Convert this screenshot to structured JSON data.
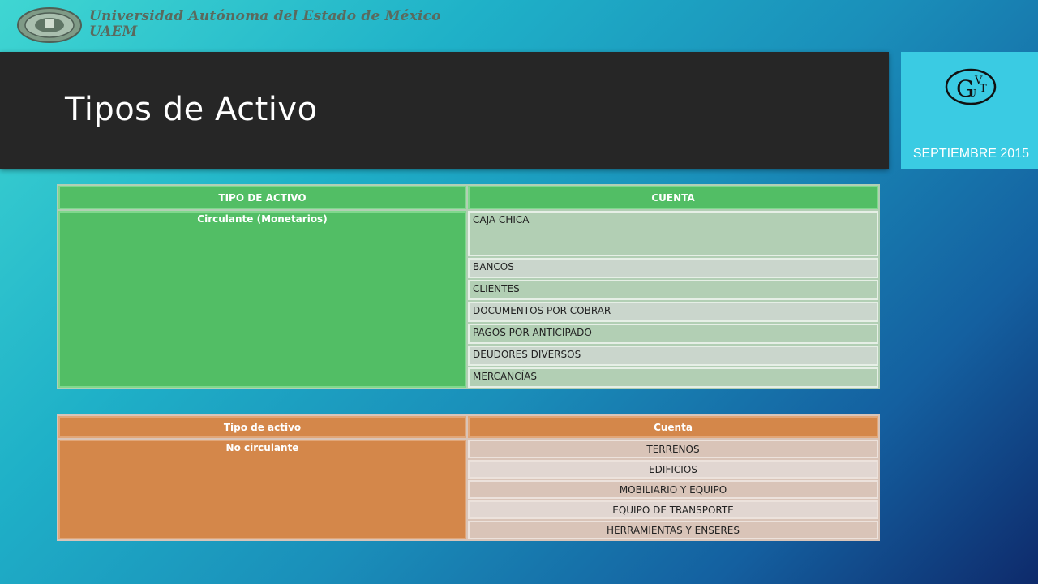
{
  "header": {
    "university": "Universidad Autónoma del Estado de México",
    "university_short": "UAEM"
  },
  "slide": {
    "title": "Tipos de Activo",
    "date": "SEPTIEMBRE 2015"
  },
  "table_current": {
    "header": [
      "TIPO DE ACTIVO",
      "CUENTA"
    ],
    "type": "Circulante (Monetarios)",
    "accounts": [
      "CAJA CHICA",
      "BANCOS",
      "CLIENTES",
      "DOCUMENTOS POR COBRAR",
      "PAGOS POR ANTICIPADO",
      "DEUDORES DIVERSOS",
      "MERCANCÍAS"
    ]
  },
  "table_noncurrent": {
    "header": [
      "Tipo de activo",
      "Cuenta"
    ],
    "type": "No circulante",
    "accounts": [
      "TERRENOS",
      "EDIFICIOS",
      "MOBILIARIO Y EQUIPO",
      "EQUIPO DE TRANSPORTE",
      "HERRAMIENTAS Y ENSERES"
    ]
  },
  "colors": {
    "title_bar": "#262626",
    "date_box": "#3acbe3",
    "green_header": "#52be65",
    "orange_header": "#d4874a"
  },
  "icons": [
    "uaem-seal-icon",
    "guyt-logo-icon"
  ]
}
